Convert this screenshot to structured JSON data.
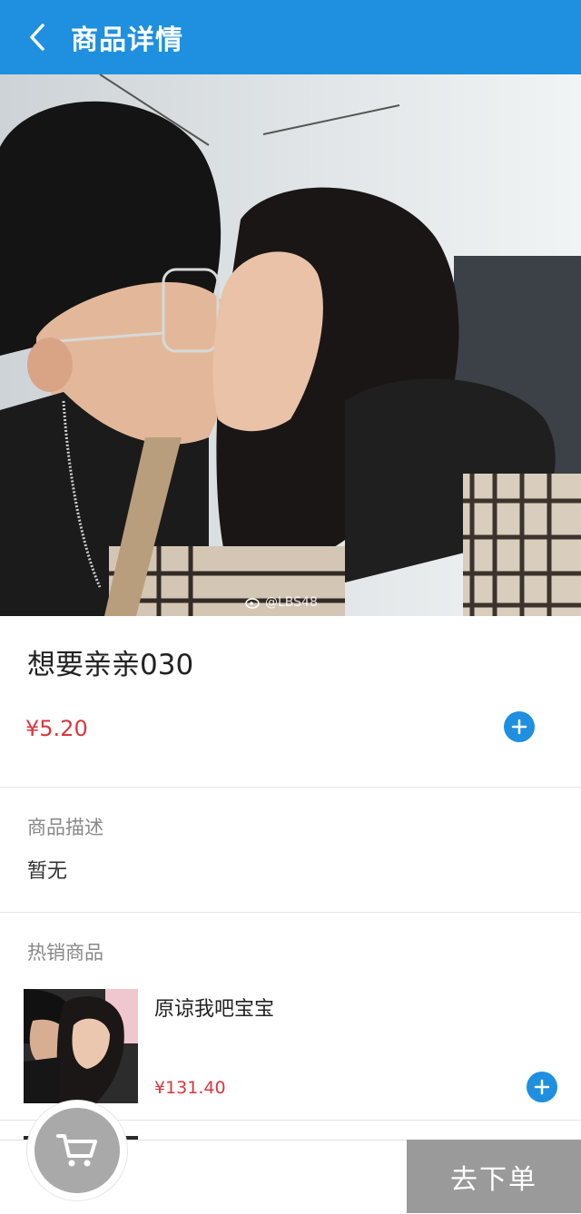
{
  "header": {
    "title": "商品详情",
    "back_icon": "chevron-left-icon"
  },
  "hero": {
    "watermark": "@LBS48",
    "watermark_icon": "weibo-icon"
  },
  "product": {
    "name": "想要亲亲030",
    "price": "¥5.20",
    "add_icon": "plus-icon"
  },
  "description": {
    "label": "商品描述",
    "text": "暂无"
  },
  "hot": {
    "label": "热销商品",
    "items": [
      {
        "name": "原谅我吧宝宝",
        "price": "¥131.40"
      }
    ]
  },
  "footer": {
    "cart_icon": "cart-icon",
    "checkout_label": "去下单"
  },
  "colors": {
    "primary": "#1f8fe0",
    "price": "#d9363e",
    "disabled": "#9a9a9a"
  }
}
